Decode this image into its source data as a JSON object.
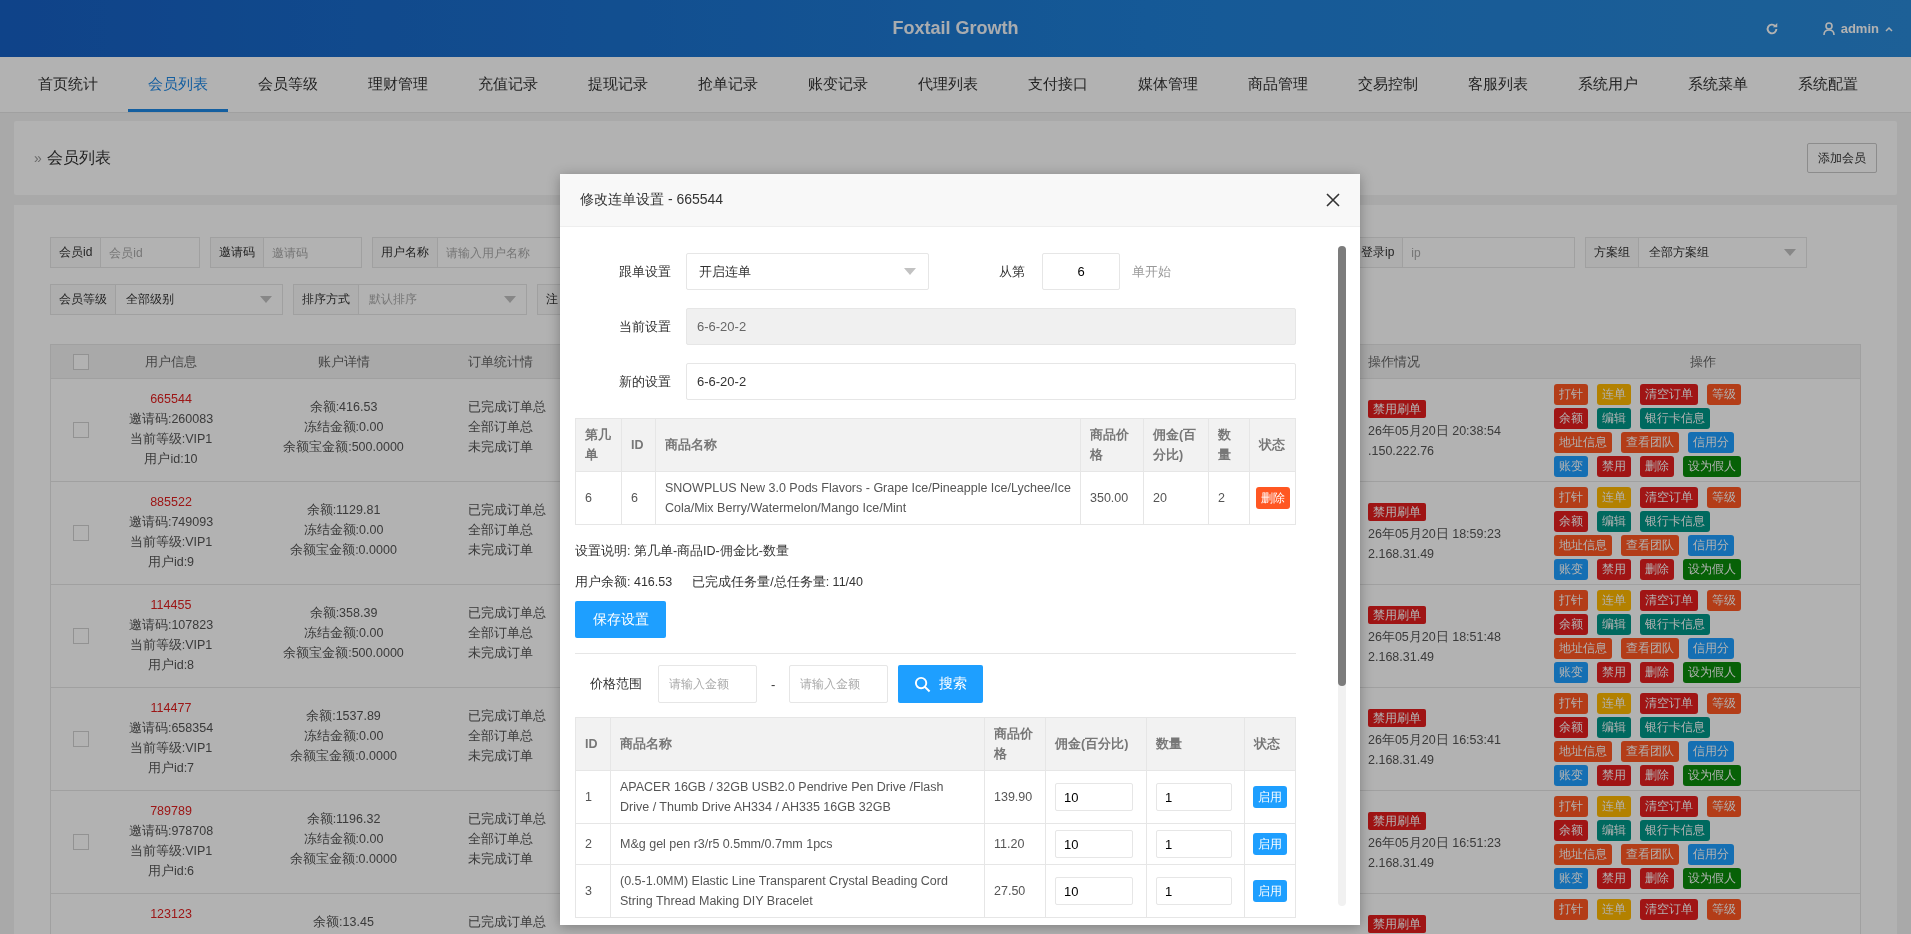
{
  "header": {
    "title": "Foxtail Growth",
    "user": "admin"
  },
  "nav": [
    {
      "label": "首页统计",
      "selected": false
    },
    {
      "label": "会员列表",
      "selected": true
    },
    {
      "label": "会员等级",
      "selected": false
    },
    {
      "label": "理财管理",
      "selected": false
    },
    {
      "label": "充值记录",
      "selected": false
    },
    {
      "label": "提现记录",
      "selected": false
    },
    {
      "label": "抢单记录",
      "selected": false
    },
    {
      "label": "账变记录",
      "selected": false
    },
    {
      "label": "代理列表",
      "selected": false
    },
    {
      "label": "支付接口",
      "selected": false
    },
    {
      "label": "媒体管理",
      "selected": false
    },
    {
      "label": "商品管理",
      "selected": false
    },
    {
      "label": "交易控制",
      "selected": false
    },
    {
      "label": "客服列表",
      "selected": false
    },
    {
      "label": "系统用户",
      "selected": false
    },
    {
      "label": "系统菜单",
      "selected": false
    },
    {
      "label": "系统配置",
      "selected": false
    }
  ],
  "breadcrumb": {
    "mark": "»",
    "title": "会员列表"
  },
  "add_button": "添加会员",
  "filters": {
    "row1_left": [
      {
        "kind": "input",
        "label": "会员id",
        "placeholder": "会员id"
      },
      {
        "kind": "input",
        "label": "邀请码",
        "placeholder": "邀请码"
      },
      {
        "kind": "input",
        "label": "用户名称",
        "placeholder": "请输入用户名称"
      }
    ],
    "row1_right": [
      {
        "kind": "input",
        "label": "登录ip",
        "placeholder": "ip"
      },
      {
        "kind": "select",
        "label": "方案组",
        "value": "全部方案组"
      }
    ],
    "row2": [
      {
        "kind": "select",
        "label": "会员等级",
        "value": "全部级别"
      },
      {
        "kind": "select",
        "label": "排序方式",
        "placeholder": "默认排序"
      },
      {
        "kind": "label",
        "label": "注"
      }
    ]
  },
  "table": {
    "all_checked": false,
    "columns": [
      "用户信息",
      "账户详情",
      "订单统计情",
      "操作情况",
      "操作"
    ],
    "rows": [
      {
        "checked": false,
        "code": "665544",
        "user_lines": [
          "邀请码:260083",
          "当前等级:VIP1",
          "用户id:10"
        ],
        "account_lines": [
          "余额:416.53",
          "冻结金额:0.00",
          "余额宝金额:500.0000"
        ],
        "order_lines": [
          "已完成订单总",
          "全部订单总",
          "未完成订单"
        ],
        "badge": "禁用刷单",
        "time": "26年05月20日 20:38:54",
        "ip": ".150.222.76",
        "actions": [
          [
            {
              "label": "打针",
              "color": "#b33d18"
            },
            {
              "label": "连单",
              "color": "#b38100"
            },
            {
              "label": "清空订单",
              "color": "#a01515"
            },
            {
              "label": "等级",
              "color": "#b33d18"
            }
          ],
          [
            {
              "label": "余额",
              "color": "#a01515"
            },
            {
              "label": "编辑",
              "color": "#00695f"
            },
            {
              "label": "银行卡信息",
              "color": "#00695f"
            }
          ],
          [
            {
              "label": "地址信息",
              "color": "#b33d18"
            },
            {
              "label": "查看团队",
              "color": "#b33d18"
            },
            {
              "label": "信用分",
              "color": "#156fb3"
            }
          ],
          [
            {
              "label": "账变",
              "color": "#156fb3"
            },
            {
              "label": "禁用",
              "color": "#a01515"
            },
            {
              "label": "删除",
              "color": "#a01515"
            },
            {
              "label": "设为假人",
              "color": "#076107"
            }
          ]
        ]
      },
      {
        "checked": false,
        "code": "885522",
        "user_lines": [
          "邀请码:749093",
          "当前等级:VIP1",
          "用户id:9"
        ],
        "account_lines": [
          "余额:1129.81",
          "冻结金额:0.00",
          "余额宝金额:0.0000"
        ],
        "order_lines": [
          "已完成订单总",
          "全部订单总",
          "未完成订单"
        ],
        "badge": "禁用刷单",
        "time": "26年05月20日 18:59:23",
        "ip": "2.168.31.49",
        "actions": [
          [
            {
              "label": "打针",
              "color": "#b33d18"
            },
            {
              "label": "连单",
              "color": "#b38100"
            },
            {
              "label": "清空订单",
              "color": "#a01515"
            },
            {
              "label": "等级",
              "color": "#b33d18"
            }
          ],
          [
            {
              "label": "余额",
              "color": "#a01515"
            },
            {
              "label": "编辑",
              "color": "#00695f"
            },
            {
              "label": "银行卡信息",
              "color": "#00695f"
            }
          ],
          [
            {
              "label": "地址信息",
              "color": "#b33d18"
            },
            {
              "label": "查看团队",
              "color": "#b33d18"
            },
            {
              "label": "信用分",
              "color": "#156fb3"
            }
          ],
          [
            {
              "label": "账变",
              "color": "#156fb3"
            },
            {
              "label": "禁用",
              "color": "#a01515"
            },
            {
              "label": "删除",
              "color": "#a01515"
            },
            {
              "label": "设为假人",
              "color": "#076107"
            }
          ]
        ]
      },
      {
        "checked": false,
        "code": "114455",
        "user_lines": [
          "邀请码:107823",
          "当前等级:VIP1",
          "用户id:8"
        ],
        "account_lines": [
          "余额:358.39",
          "冻结金额:0.00",
          "余额宝金额:500.0000"
        ],
        "order_lines": [
          "已完成订单总",
          "全部订单总",
          "未完成订单"
        ],
        "badge": "禁用刷单",
        "time": "26年05月20日 18:51:48",
        "ip": "2.168.31.49",
        "actions": [
          [
            {
              "label": "打针",
              "color": "#b33d18"
            },
            {
              "label": "连单",
              "color": "#b38100"
            },
            {
              "label": "清空订单",
              "color": "#a01515"
            },
            {
              "label": "等级",
              "color": "#b33d18"
            }
          ],
          [
            {
              "label": "余额",
              "color": "#a01515"
            },
            {
              "label": "编辑",
              "color": "#00695f"
            },
            {
              "label": "银行卡信息",
              "color": "#00695f"
            }
          ],
          [
            {
              "label": "地址信息",
              "color": "#b33d18"
            },
            {
              "label": "查看团队",
              "color": "#b33d18"
            },
            {
              "label": "信用分",
              "color": "#156fb3"
            }
          ],
          [
            {
              "label": "账变",
              "color": "#156fb3"
            },
            {
              "label": "禁用",
              "color": "#a01515"
            },
            {
              "label": "删除",
              "color": "#a01515"
            },
            {
              "label": "设为假人",
              "color": "#076107"
            }
          ]
        ]
      },
      {
        "checked": false,
        "code": "114477",
        "user_lines": [
          "邀请码:658354",
          "当前等级:VIP1",
          "用户id:7"
        ],
        "account_lines": [
          "余额:1537.89",
          "冻结金额:0.00",
          "余额宝金额:0.0000"
        ],
        "order_lines": [
          "已完成订单总",
          "全部订单总",
          "未完成订单"
        ],
        "badge": "禁用刷单",
        "time": "26年05月20日 16:53:41",
        "ip": "2.168.31.49",
        "actions": [
          [
            {
              "label": "打针",
              "color": "#b33d18"
            },
            {
              "label": "连单",
              "color": "#b38100"
            },
            {
              "label": "清空订单",
              "color": "#a01515"
            },
            {
              "label": "等级",
              "color": "#b33d18"
            }
          ],
          [
            {
              "label": "余额",
              "color": "#a01515"
            },
            {
              "label": "编辑",
              "color": "#00695f"
            },
            {
              "label": "银行卡信息",
              "color": "#00695f"
            }
          ],
          [
            {
              "label": "地址信息",
              "color": "#b33d18"
            },
            {
              "label": "查看团队",
              "color": "#b33d18"
            },
            {
              "label": "信用分",
              "color": "#156fb3"
            }
          ],
          [
            {
              "label": "账变",
              "color": "#156fb3"
            },
            {
              "label": "禁用",
              "color": "#a01515"
            },
            {
              "label": "删除",
              "color": "#a01515"
            },
            {
              "label": "设为假人",
              "color": "#076107"
            }
          ]
        ]
      },
      {
        "checked": false,
        "code": "789789",
        "user_lines": [
          "邀请码:978708",
          "当前等级:VIP1",
          "用户id:6"
        ],
        "account_lines": [
          "余额:1196.32",
          "冻结金额:0.00",
          "余额宝金额:0.0000"
        ],
        "order_lines": [
          "已完成订单总",
          "全部订单总",
          "未完成订单"
        ],
        "badge": "禁用刷单",
        "time": "26年05月20日 16:51:23",
        "ip": "2.168.31.49",
        "actions": [
          [
            {
              "label": "打针",
              "color": "#b33d18"
            },
            {
              "label": "连单",
              "color": "#b38100"
            },
            {
              "label": "清空订单",
              "color": "#a01515"
            },
            {
              "label": "等级",
              "color": "#b33d18"
            }
          ],
          [
            {
              "label": "余额",
              "color": "#a01515"
            },
            {
              "label": "编辑",
              "color": "#00695f"
            },
            {
              "label": "银行卡信息",
              "color": "#00695f"
            }
          ],
          [
            {
              "label": "地址信息",
              "color": "#b33d18"
            },
            {
              "label": "查看团队",
              "color": "#b33d18"
            },
            {
              "label": "信用分",
              "color": "#156fb3"
            }
          ],
          [
            {
              "label": "账变",
              "color": "#156fb3"
            },
            {
              "label": "禁用",
              "color": "#a01515"
            },
            {
              "label": "删除",
              "color": "#a01515"
            },
            {
              "label": "设为假人",
              "color": "#076107"
            }
          ]
        ]
      },
      {
        "code": "123123",
        "user_lines": [],
        "account_lines": [
          "余额:13.45"
        ],
        "order_lines": [
          "已完成订单总"
        ],
        "badge": "禁用刷单",
        "actions": [
          [
            {
              "label": "打针",
              "color": "#b33d18"
            },
            {
              "label": "连单",
              "color": "#b38100"
            },
            {
              "label": "清空订单",
              "color": "#a01515"
            },
            {
              "label": "等级",
              "color": "#b33d18"
            }
          ]
        ]
      }
    ]
  },
  "modal": {
    "title": "修改连单设置 - 665544",
    "form": {
      "follow_label": "跟单设置",
      "follow_value": "开启连单",
      "from_label": "从第",
      "from_value": "6",
      "from_suffix": "单开始",
      "current_label": "当前设置",
      "current_value": "6-6-20-2",
      "new_label": "新的设置",
      "new_value": "6-6-20-2"
    },
    "chain_table": {
      "columns": [
        "第几单",
        "ID",
        "商品名称",
        "商品价格",
        "佣金(百分比)",
        "数量",
        "状态"
      ],
      "rows": [
        {
          "order": "6",
          "id": "6",
          "name": "SNOWPLUS New 3.0 Pods Flavors - Grape Ice/Pineapple Ice/Lychee/Ice Cola/Mix Berry/Watermelon/Mango Ice/Mint",
          "price": "350.00",
          "commission": "20",
          "quantity": "2",
          "action": "删除"
        }
      ]
    },
    "note": "设置说明: 第几单-商品ID-佣金比-数量",
    "balance": "用户余额: 416.53",
    "progress": "已完成任务量/总任务量: 11/40",
    "save_button": "保存设置",
    "price_filter": {
      "label": "价格范围",
      "min_placeholder": "请输入金额",
      "separator": "-",
      "max_placeholder": "请输入金额",
      "search_button": "搜索"
    },
    "goods_table": {
      "columns": [
        "ID",
        "商品名称",
        "商品价格",
        "佣金(百分比)",
        "数量",
        "状态"
      ],
      "rows": [
        {
          "id": "1",
          "name": "APACER 16GB / 32GB USB2.0 Pendrive Pen Drive /Flash Drive / Thumb Drive AH334 / AH335 16GB 32GB",
          "price": "139.90",
          "commission": "10",
          "quantity": "1",
          "action": "启用"
        },
        {
          "id": "2",
          "name": "M&g gel pen r3/r5 0.5mm/0.7mm 1pcs",
          "price": "11.20",
          "commission": "10",
          "quantity": "1",
          "action": "启用"
        },
        {
          "id": "3",
          "name": "(0.5-1.0MM) Elastic Line Transparent Crystal Beading Cord String Thread Making DIY Bracelet",
          "price": "27.50",
          "commission": "10",
          "quantity": "1",
          "action": "启用"
        }
      ]
    }
  }
}
